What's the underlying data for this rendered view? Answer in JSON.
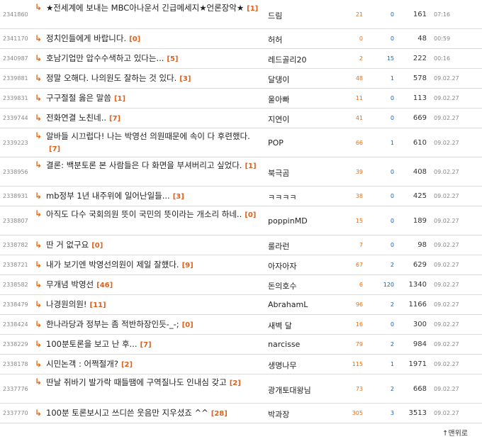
{
  "rows": [
    {
      "num": "2341860",
      "title": "★전세계에 보내는 MBC아나운서 긴급메세지★언론장악★",
      "comments": "[1]",
      "author": "드림",
      "rec": "21",
      "opp": "0",
      "hits": "161",
      "date": "07:16",
      "tall": true
    },
    {
      "num": "2341170",
      "title": "정치인들에게 바랍니다.",
      "comments": "[0]",
      "author": "허허",
      "rec": "0",
      "opp": "0",
      "hits": "48",
      "date": "00:59",
      "tall": false
    },
    {
      "num": "2340987",
      "title": "호남기업만 압수수색하고 있다는...",
      "comments": "[5]",
      "author": "레드골리20",
      "rec": "2",
      "opp": "15",
      "hits": "222",
      "date": "00:16",
      "tall": false
    },
    {
      "num": "2339881",
      "title": "정말 오해다. 나의원도 잘하는 것 있다.",
      "comments": "[3]",
      "author": "달댕이",
      "rec": "48",
      "opp": "1",
      "hits": "578",
      "date": "09.02.27",
      "tall": false
    },
    {
      "num": "2339831",
      "title": "구구절절 옳은 말씀",
      "comments": "[1]",
      "author": "울아빠",
      "rec": "11",
      "opp": "0",
      "hits": "113",
      "date": "09.02.27",
      "tall": false
    },
    {
      "num": "2339744",
      "title": "전화연결 노친네..",
      "comments": "[7]",
      "author": "지연이",
      "rec": "41",
      "opp": "0",
      "hits": "669",
      "date": "09.02.27",
      "tall": false
    },
    {
      "num": "2339223",
      "title": "알바들 시끄럽다! 나는 박영선 의원때문에 속이 다 후련했다.",
      "comments": "[7]",
      "author": "POP",
      "rec": "66",
      "opp": "1",
      "hits": "610",
      "date": "09.02.27",
      "tall": true
    },
    {
      "num": "2338956",
      "title": "결론: 백분토론 본 사람들은 다 화면을 부셔버리고 싶었다.",
      "comments": "[1]",
      "author": "북극곰",
      "rec": "39",
      "opp": "0",
      "hits": "408",
      "date": "09.02.27",
      "tall": true
    },
    {
      "num": "2338931",
      "title": "mb정부 1년 내주위에 일어난일들...",
      "comments": "[3]",
      "author": "ㅋㅋㅋㅋ",
      "rec": "38",
      "opp": "0",
      "hits": "425",
      "date": "09.02.27",
      "tall": false
    },
    {
      "num": "2338807",
      "title": "아직도 다수 국회의원 뜻이 국민의 뜻이라는 개소리 하네..",
      "comments": "[0]",
      "author": "poppinMD",
      "rec": "15",
      "opp": "0",
      "hits": "189",
      "date": "09.02.27",
      "tall": true
    },
    {
      "num": "2338782",
      "title": "딴 거 없구요",
      "comments": "[0]",
      "author": "룰라런",
      "rec": "7",
      "opp": "0",
      "hits": "98",
      "date": "09.02.27",
      "tall": false
    },
    {
      "num": "2338721",
      "title": "내가 보기엔 박영선의원이 제일 잘했다.",
      "comments": "[9]",
      "author": "아자아자",
      "rec": "67",
      "opp": "2",
      "hits": "629",
      "date": "09.02.27",
      "tall": false
    },
    {
      "num": "2338582",
      "title": "무개념 박영선",
      "comments": "[46]",
      "author": "돈의호수",
      "rec": "6",
      "opp": "120",
      "hits": "1340",
      "date": "09.02.27",
      "tall": false
    },
    {
      "num": "2338479",
      "title": "나경원의원!",
      "comments": "[11]",
      "author": "AbrahamL",
      "rec": "96",
      "opp": "2",
      "hits": "1166",
      "date": "09.02.27",
      "tall": false
    },
    {
      "num": "2338424",
      "title": "한나라당과 정부는 좀 적반하장인듯-_-;",
      "comments": "[0]",
      "author": "새벽 달",
      "rec": "16",
      "opp": "0",
      "hits": "300",
      "date": "09.02.27",
      "tall": false
    },
    {
      "num": "2338229",
      "title": "100분토론을 보고 난 후...",
      "comments": "[7]",
      "author": "narcisse",
      "rec": "79",
      "opp": "2",
      "hits": "984",
      "date": "09.02.27",
      "tall": false
    },
    {
      "num": "2338178",
      "title": "시민논객 : 어쩍절개?",
      "comments": "[2]",
      "author": "생명나무",
      "rec": "115",
      "opp": "1",
      "hits": "1971",
      "date": "09.02.27",
      "tall": false
    },
    {
      "num": "2337776",
      "title": "딴날 쥐바기 발가락 때들땜에 구역질나도 인내심 갖고",
      "comments": "[2]",
      "author": "광개토대왕님",
      "rec": "73",
      "opp": "2",
      "hits": "668",
      "date": "09.02.27",
      "tall": true
    },
    {
      "num": "2337770",
      "title": "100분 토론보시고 쓰디쓴 웃음만 지우셨죠 ^^",
      "comments": "[28]",
      "author": "박과장",
      "rec": "305",
      "opp": "3",
      "hits": "3513",
      "date": "09.02.27",
      "tall": false
    }
  ],
  "footer": {
    "top_label": "맨위로",
    "top_icon": "↑"
  }
}
